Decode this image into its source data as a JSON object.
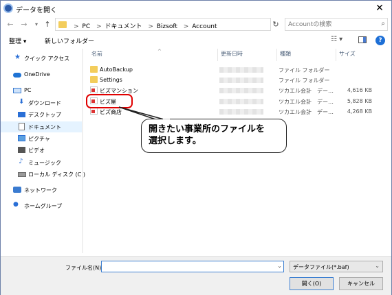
{
  "window": {
    "title": "データを開く"
  },
  "nav": {
    "back": "←",
    "forward": "→",
    "recent": "▾",
    "up": "↑",
    "breadcrumb": [
      "PC",
      "ドキュメント",
      "Bizsoft",
      "Account"
    ],
    "separator": ">",
    "refresh": "↻",
    "search_placeholder": "Accountの検索"
  },
  "toolbar": {
    "organize": "整理 ▾",
    "new_folder": "新しいフォルダー"
  },
  "sidebar": {
    "items": [
      {
        "label": "クイック アクセス"
      },
      {
        "label": "OneDrive"
      },
      {
        "label": "PC"
      },
      {
        "label": "ダウンロード"
      },
      {
        "label": "デスクトップ"
      },
      {
        "label": "ドキュメント"
      },
      {
        "label": "ピクチャ"
      },
      {
        "label": "ビデオ"
      },
      {
        "label": "ミュージック"
      },
      {
        "label": "ローカル ディスク (C:)"
      },
      {
        "label": "ネットワーク"
      },
      {
        "label": "ホームグループ"
      }
    ]
  },
  "columns": {
    "name": "名前",
    "date": "更新日時",
    "type": "種類",
    "size": "サイズ"
  },
  "files": [
    {
      "name": "AutoBackup",
      "type": "ファイル フォルダー",
      "size": ""
    },
    {
      "name": "Settings",
      "type": "ファイル フォルダー",
      "size": ""
    },
    {
      "name": "ビズマンション",
      "type": "ツカエル会計　デー…",
      "size": "4,616 KB"
    },
    {
      "name": "ビズ屋",
      "type": "ツカエル会計　デー…",
      "size": "5,828 KB"
    },
    {
      "name": "ビズ商店",
      "type": "ツカエル会計　デー…",
      "size": "4,268 KB"
    }
  ],
  "callout": {
    "text": "開きたい事業所のファイルを\n選択します。"
  },
  "footer": {
    "filename_label": "ファイル名(N):",
    "filename_value": "",
    "filetype": "データファイル(*.baf)",
    "open": "開く(O)",
    "cancel": "キャンセル"
  },
  "colors": {
    "accent": "#3c7fd1",
    "highlight": "#e00000"
  }
}
